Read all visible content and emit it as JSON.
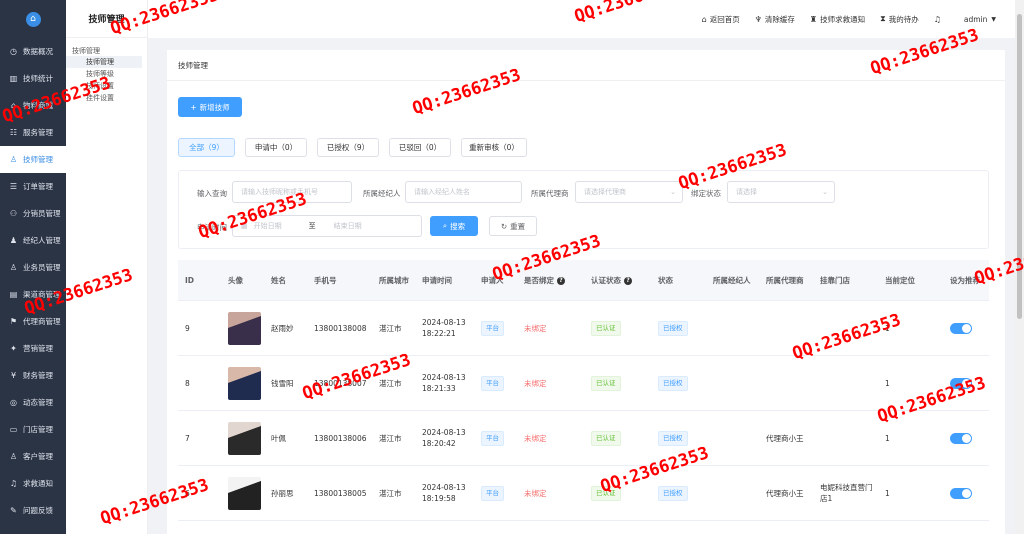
{
  "sidebar": {
    "items": [
      {
        "label": "数据概况",
        "icon": "clock-icon"
      },
      {
        "label": "技师统计",
        "icon": "bar-chart-icon"
      },
      {
        "label": "物料商城",
        "icon": "shop-icon"
      },
      {
        "label": "服务管理",
        "icon": "service-icon"
      },
      {
        "label": "技师管理",
        "icon": "user-icon"
      },
      {
        "label": "订单管理",
        "icon": "order-icon"
      },
      {
        "label": "分销员管理",
        "icon": "share-icon"
      },
      {
        "label": "经纪人管理",
        "icon": "agent-icon"
      },
      {
        "label": "业务员管理",
        "icon": "staff-icon"
      },
      {
        "label": "渠道商管理",
        "icon": "channel-icon"
      },
      {
        "label": "代理商管理",
        "icon": "proxy-icon"
      },
      {
        "label": "营销管理",
        "icon": "marketing-icon"
      },
      {
        "label": "财务管理",
        "icon": "finance-icon"
      },
      {
        "label": "动态管理",
        "icon": "dynamic-icon"
      },
      {
        "label": "门店管理",
        "icon": "store-icon"
      },
      {
        "label": "客户管理",
        "icon": "customer-icon"
      },
      {
        "label": "求救通知",
        "icon": "bell-icon"
      },
      {
        "label": "问题反馈",
        "icon": "feedback-icon"
      }
    ]
  },
  "subnav": {
    "title": "技师管理",
    "group": "技师管理",
    "items": [
      "技师管理",
      "技师等级",
      "技师设置",
      "挂件设置"
    ]
  },
  "topbar": {
    "items": [
      {
        "label": "返回首页",
        "icon": "home-icon"
      },
      {
        "label": "清除缓存",
        "icon": "broom-icon"
      },
      {
        "label": "技师求救通知",
        "icon": "alarm-icon"
      },
      {
        "label": "我的待办",
        "icon": "hourglass-icon"
      },
      {
        "label": "",
        "icon": "bell-icon"
      }
    ],
    "user": "admin"
  },
  "breadcrumb": "技师管理",
  "add_button": "新增技师",
  "tabs": [
    {
      "label": "全部（9）"
    },
    {
      "label": "申请中（0）"
    },
    {
      "label": "已授权（9）"
    },
    {
      "label": "已驳回（0）"
    },
    {
      "label": "重新审核（0）"
    }
  ],
  "filter": {
    "query_label": "输入查询",
    "query_placeholder": "请输入技师昵称或手机号",
    "agent_label": "所属经纪人",
    "agent_placeholder": "请输入经纪人姓名",
    "proxy_label": "所属代理商",
    "proxy_placeholder": "请选择代理商",
    "bind_label": "绑定状态",
    "bind_placeholder": "请选择",
    "date_label": "申请时间",
    "start_placeholder": "开始日期",
    "date_sep": "至",
    "end_placeholder": "结束日期",
    "search_button": "搜索",
    "reset_button": "重置"
  },
  "table": {
    "headers": [
      "ID",
      "头像",
      "姓名",
      "手机号",
      "所属城市",
      "申请时间",
      "申请人",
      "是否绑定",
      "认证状态",
      "状态",
      "所属经纪人",
      "所属代理商",
      "挂靠门店",
      "当前定位",
      "设为推荐"
    ],
    "rows": [
      {
        "id": "9",
        "name": "赵雨妙",
        "phone": "13800138008",
        "city": "湛江市",
        "date": "2024-08-13",
        "time": "18:22:21",
        "applicant": "平台",
        "bind": "未绑定",
        "cert": "已认证",
        "status": "已授权",
        "agent": "",
        "proxy": "",
        "store": "",
        "loc": "1",
        "recommend": true
      },
      {
        "id": "8",
        "name": "钱雪阳",
        "phone": "13800138007",
        "city": "湛江市",
        "date": "2024-08-13",
        "time": "18:21:33",
        "applicant": "平台",
        "bind": "未绑定",
        "cert": "已认证",
        "status": "已授权",
        "agent": "",
        "proxy": "",
        "store": "",
        "loc": "1",
        "recommend": true
      },
      {
        "id": "7",
        "name": "叶佩",
        "phone": "13800138006",
        "city": "湛江市",
        "date": "2024-08-13",
        "time": "18:20:42",
        "applicant": "平台",
        "bind": "未绑定",
        "cert": "已认证",
        "status": "已授权",
        "agent": "",
        "proxy": "代理商小王",
        "store": "",
        "loc": "1",
        "recommend": true
      },
      {
        "id": "6",
        "name": "孙丽思",
        "phone": "13800138005",
        "city": "湛江市",
        "date": "2024-08-13",
        "time": "18:19:58",
        "applicant": "平台",
        "bind": "未绑定",
        "cert": "已认证",
        "status": "已授权",
        "agent": "",
        "proxy": "代理商小王",
        "store": "电妮科技直营门店1",
        "loc": "1",
        "recommend": true
      }
    ]
  },
  "watermark": "QQ:23662353",
  "colors": {
    "primary": "#409eff",
    "sidebar_bg": "#2b3445",
    "success": "#67c23a",
    "danger": "#f56c6c"
  }
}
